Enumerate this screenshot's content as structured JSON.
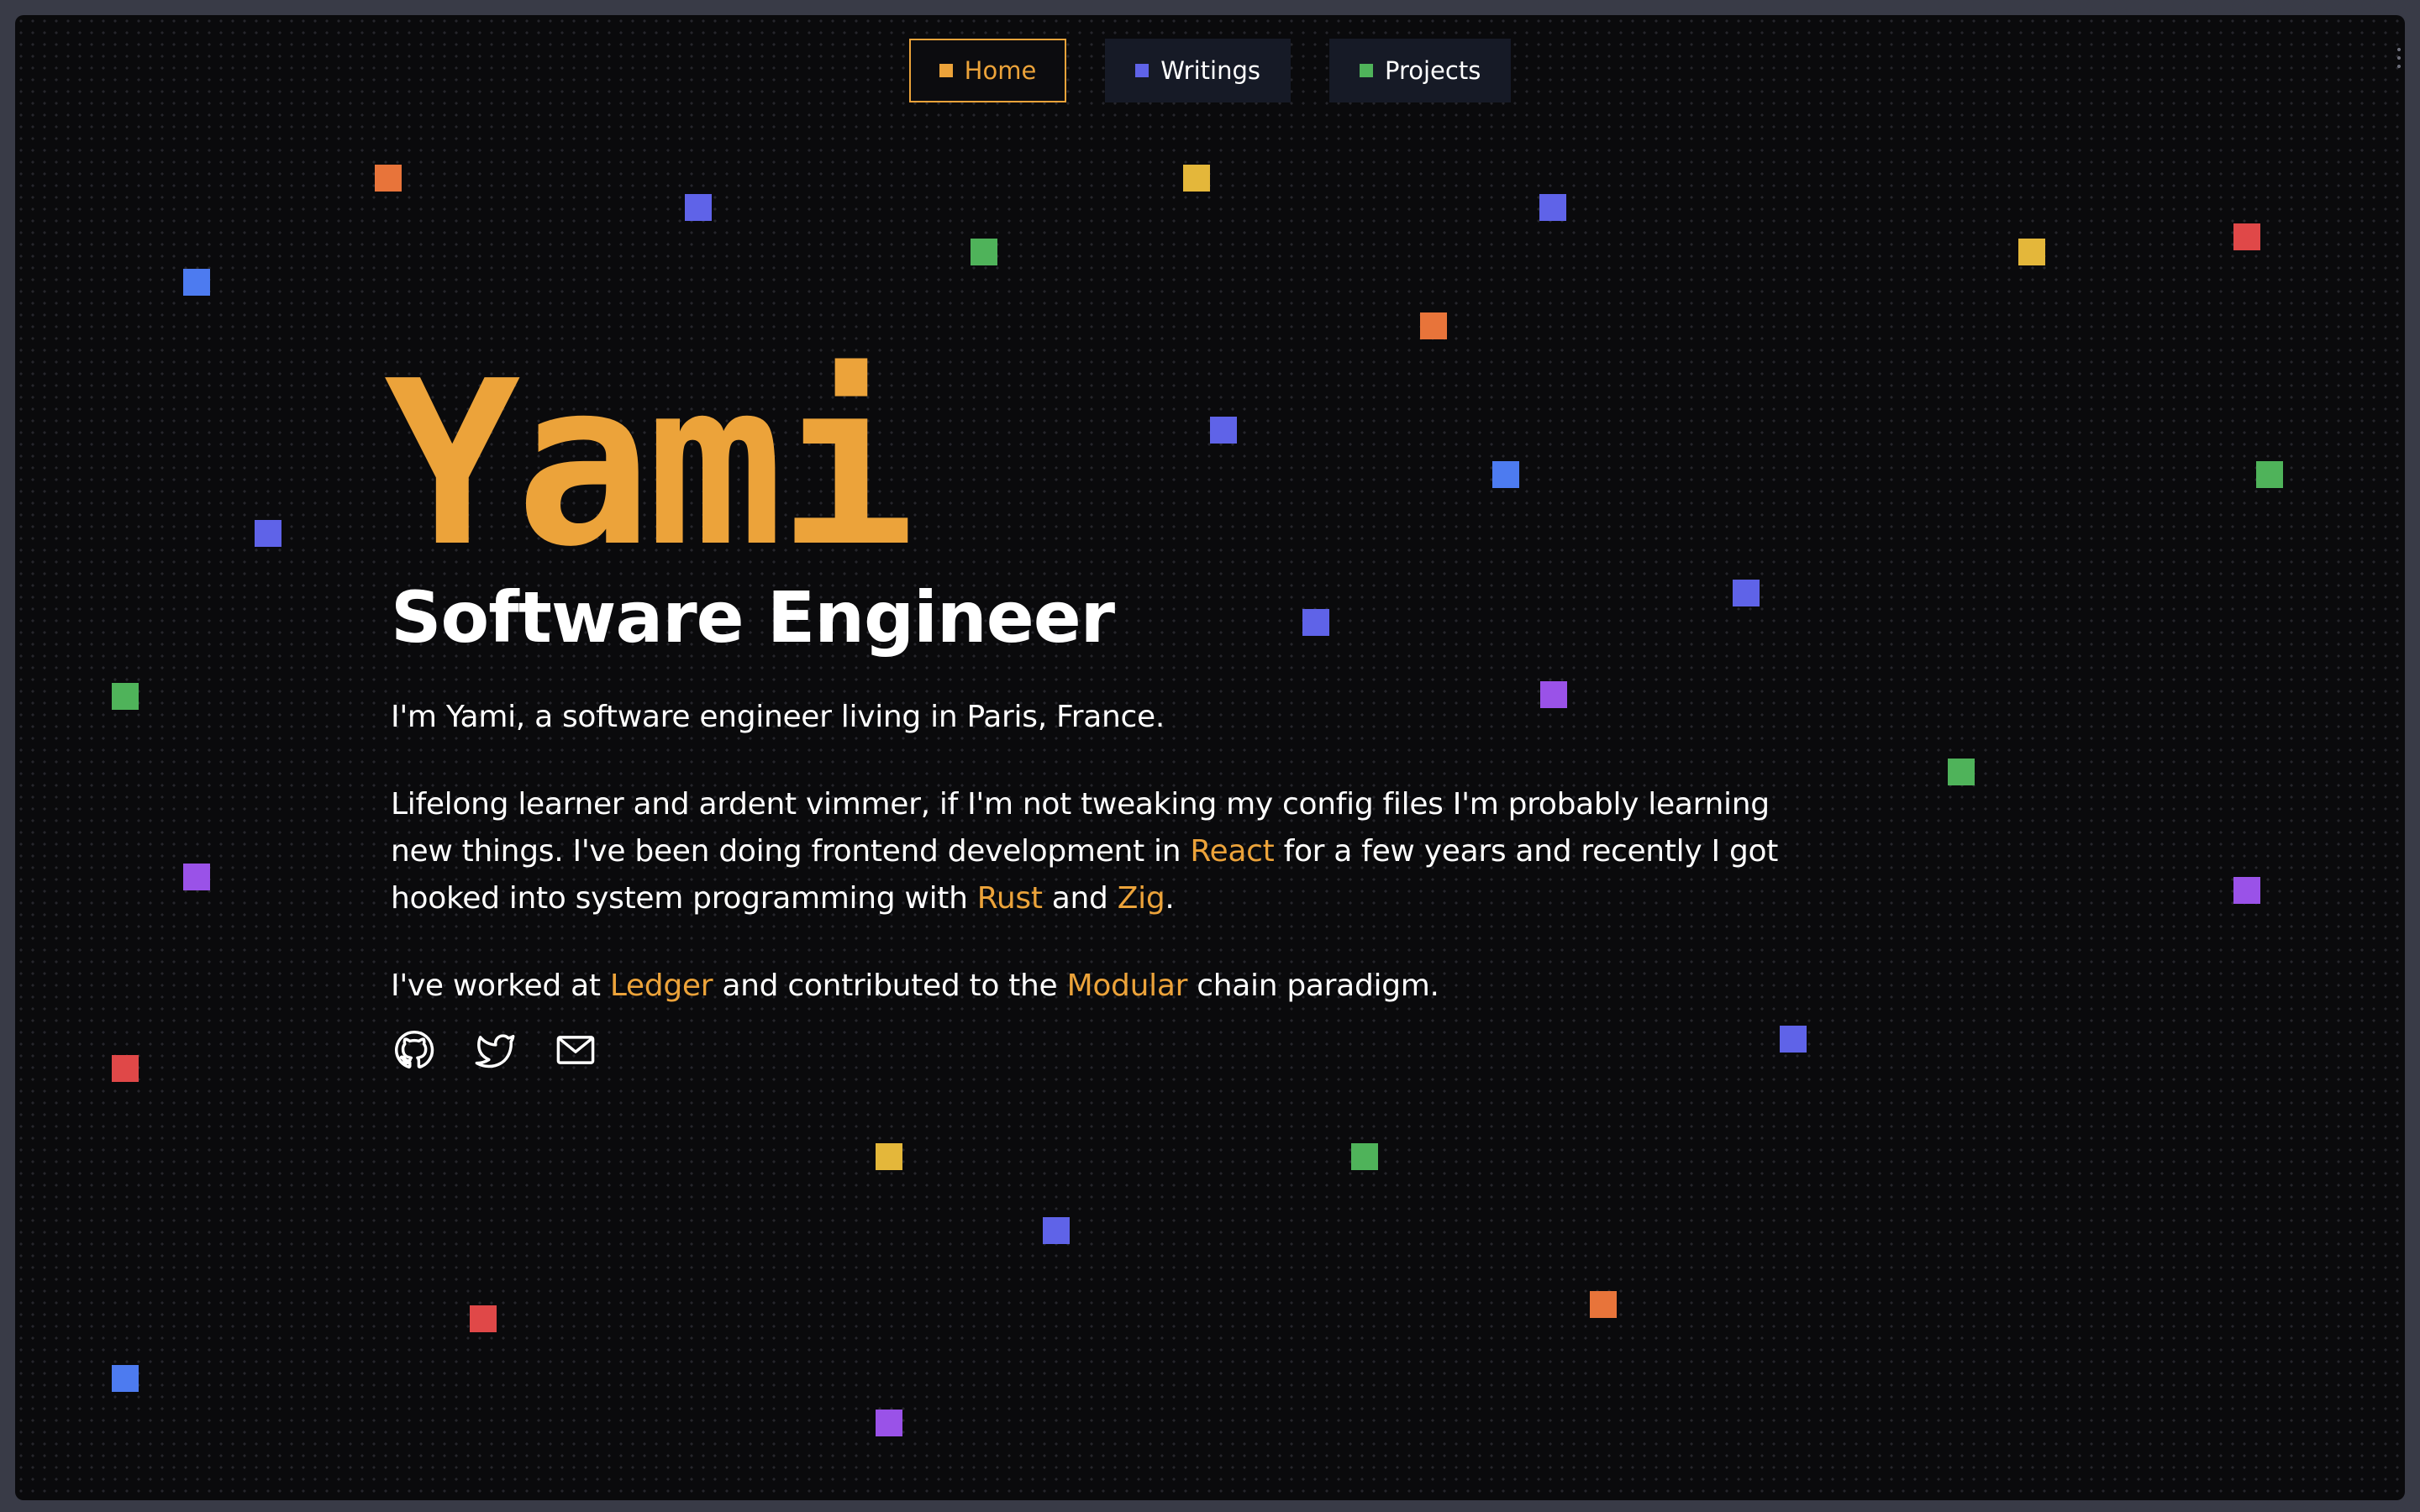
{
  "nav": {
    "items": [
      {
        "label": "Home",
        "color": "#eca33a"
      },
      {
        "label": "Writings",
        "color": "#5f63e8"
      },
      {
        "label": "Projects",
        "color": "#4fb35a"
      }
    ]
  },
  "hero": {
    "name": "Yami",
    "title": "Software Engineer"
  },
  "intro": {
    "p1": "I'm Yami, a software engineer living in Paris, France.",
    "p2_a": "Lifelong learner and ardent vimmer, if I'm not tweaking my config files I'm probably learning new things. I've been doing frontend development in ",
    "p2_link_react": "React",
    "p2_b": " for a few years and recently I got hooked into system programming with ",
    "p2_link_rust": "Rust",
    "p2_c": " and ",
    "p2_link_zig": "Zig",
    "p2_d": ".",
    "p3_a": "I've worked at ",
    "p3_link_ledger": "Ledger",
    "p3_b": " and contributed to the ",
    "p3_link_modular": "Modular",
    "p3_c": " chain paradigm."
  },
  "socials": [
    "github-icon",
    "twitter-icon",
    "mail-icon"
  ],
  "colors": {
    "accent": "#eca33a",
    "background": "#0a0a0c",
    "text": "#ffffff",
    "square_palette": [
      "#e8743a",
      "#5f63e8",
      "#e4b73a",
      "#4fb35a",
      "#4d7bf0",
      "#e04848",
      "#9a52e8"
    ]
  }
}
